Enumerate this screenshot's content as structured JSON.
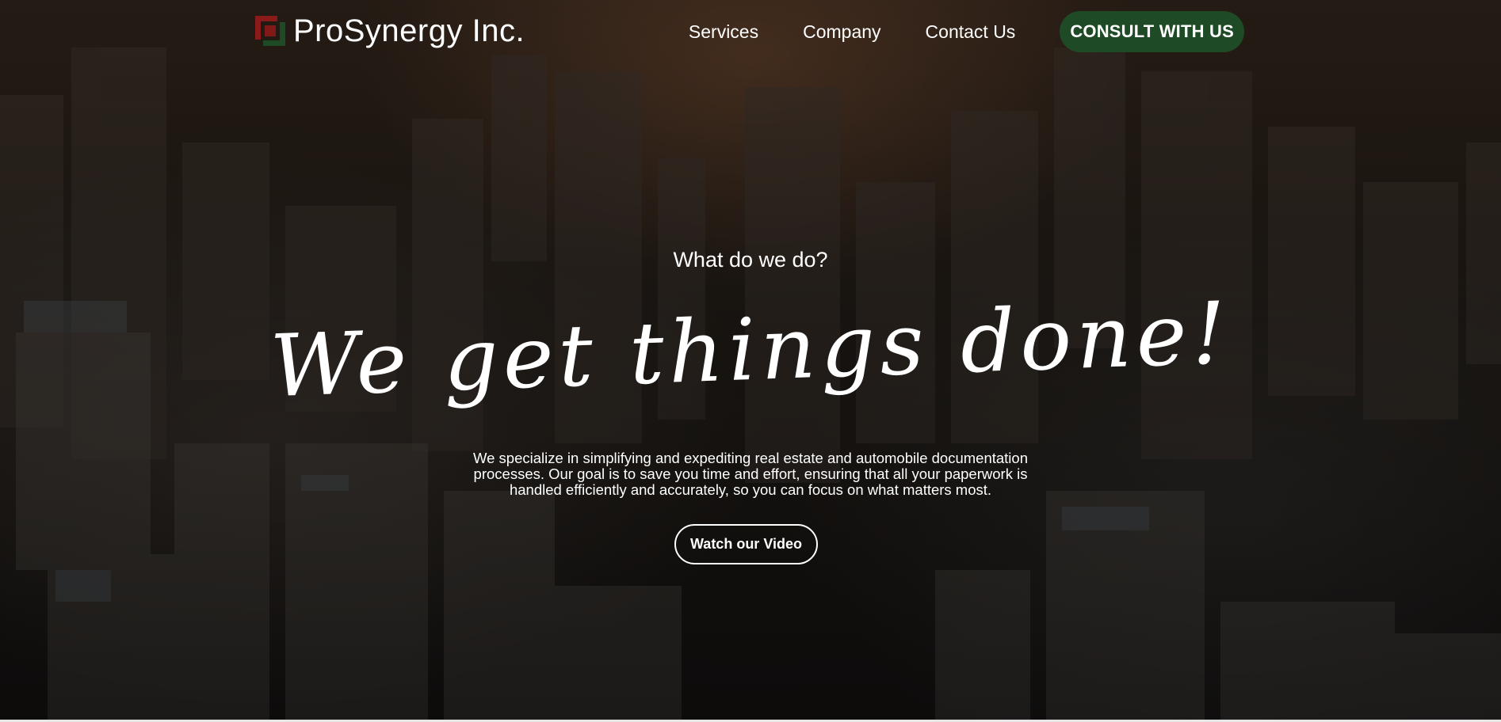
{
  "brand": {
    "name": "ProSynergy Inc.",
    "logo_icon": "square-bracket-logo-icon",
    "logo_colors": [
      "#8b1a1a",
      "#1f4a26"
    ]
  },
  "nav": {
    "items": [
      {
        "label": "Services"
      },
      {
        "label": "Company"
      },
      {
        "label": "Contact Us"
      }
    ],
    "cta_label": "CONSULT WITH US",
    "cta_color": "#1f4a26"
  },
  "hero": {
    "eyebrow": "What do we do?",
    "headline": "We get things done!",
    "description": "We specialize in simplifying and expediting real estate and automobile documentation processes. Our goal is to save you time and effort, ensuring that all your paperwork is handled efficiently and accurately, so you can focus on what matters most.",
    "video_button_label": "Watch our Video",
    "background": "aerial-city-skyline-image"
  }
}
